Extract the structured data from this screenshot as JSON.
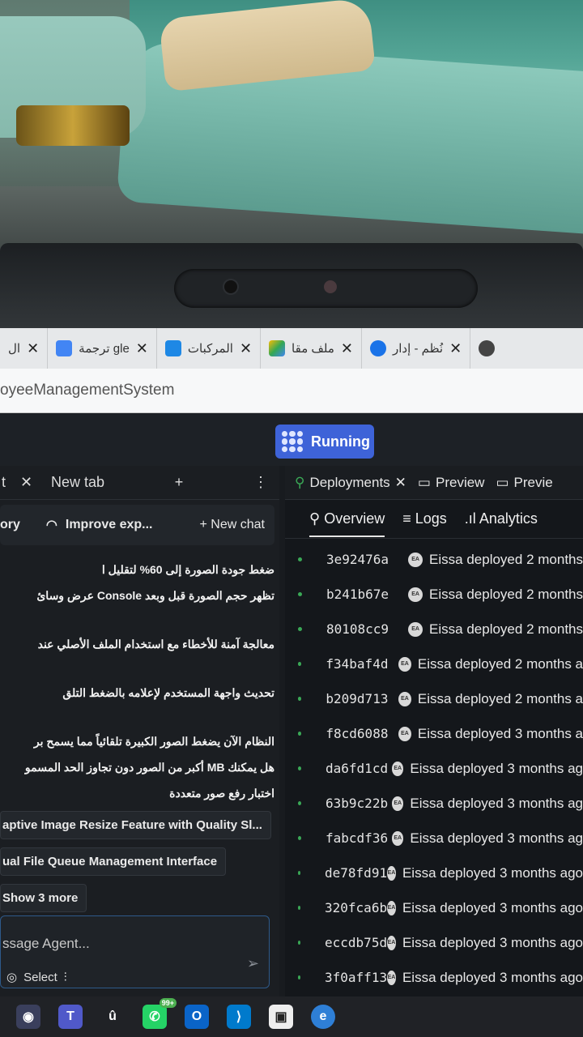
{
  "browser": {
    "tabs": [
      {
        "label": "ال",
        "favicon_color": "#ffffff"
      },
      {
        "label": "ترجمة gle",
        "favicon_color": "#4285f4"
      },
      {
        "label": "المركبات",
        "favicon_color": "#1e88e5"
      },
      {
        "label": "ملف مقا",
        "favicon_color": "#fbbc05"
      },
      {
        "label": "نُظم - إدار",
        "favicon_color": "#1a73e8"
      },
      {
        "label": "",
        "favicon_color": "#444444"
      }
    ],
    "address": "oyeeManagementSystem"
  },
  "app": {
    "run_button": {
      "label": "Running",
      "color": "#3e63d8"
    },
    "left": {
      "tab_prev": "t",
      "tab_new": "New tab",
      "tab_add": "+",
      "tab_menu": "⋮",
      "toolbar": {
        "history": "ory",
        "improve": "Improve exp...",
        "new_chat": "+ New chat"
      },
      "messages": [
        "ضغط جودة الصورة إلى 60% لتقليل ا",
        "تظهر حجم الصورة قبل وبعد Console عرض وسائ",
        "معالجة آمنة للأخطاء مع استخدام الملف الأصلي عند",
        "تحديث واجهة المستخدم لإعلامه بالضغط التلق",
        "النظام الآن يضغط الصور الكبيرة تلقائياً مما يسمح بر",
        "هل يمكنك MB أكبر من الصور دون تجاوز الحد المسمو",
        "اختبار رفع صور متعددة"
      ],
      "chips": [
        "aptive Image Resize Feature with Quality Sl...",
        "ual File Queue Management Interface",
        "Show 3 more"
      ],
      "input_placeholder": "ssage Agent...",
      "select_label": "Select"
    },
    "right": {
      "tabs": [
        {
          "label": "Deployments"
        },
        {
          "label": "Preview"
        },
        {
          "label": "Previe"
        }
      ],
      "nav": {
        "overview": "Overview",
        "logs": "Logs",
        "analytics": "Analytics"
      },
      "deployments": [
        {
          "hash": "3e92476a",
          "text": "Eissa deployed 2 months"
        },
        {
          "hash": "b241b67e",
          "text": "Eissa deployed 2 months"
        },
        {
          "hash": "80108cc9",
          "text": "Eissa deployed 2 months"
        },
        {
          "hash": "f34baf4d",
          "text": "Eissa deployed 2 months a"
        },
        {
          "hash": "b209d713",
          "text": "Eissa deployed 2 months a"
        },
        {
          "hash": "f8cd6088",
          "text": "Eissa deployed 3 months a"
        },
        {
          "hash": "da6fd1cd",
          "text": "Eissa deployed 3 months ag"
        },
        {
          "hash": "63b9c22b",
          "text": "Eissa deployed 3 months ag"
        },
        {
          "hash": "fabcdf36",
          "text": "Eissa deployed 3 months ag"
        },
        {
          "hash": "de78fd91",
          "text": "Eissa deployed 3 months ago"
        },
        {
          "hash": "320fca6b",
          "text": "Eissa deployed 3 months ago"
        },
        {
          "hash": "eccdb75d",
          "text": "Eissa deployed 3 months ago"
        },
        {
          "hash": "3f0aff13",
          "text": "Eissa deployed 3 months ago"
        }
      ],
      "avatar_initials": "EA"
    }
  },
  "taskbar": {
    "badge": "99+",
    "icons": [
      "chat-icon",
      "teams-icon",
      "u-icon",
      "whatsapp-icon",
      "outlook-icon",
      "vscode-icon",
      "terminal-icon",
      "edge-icon"
    ]
  }
}
